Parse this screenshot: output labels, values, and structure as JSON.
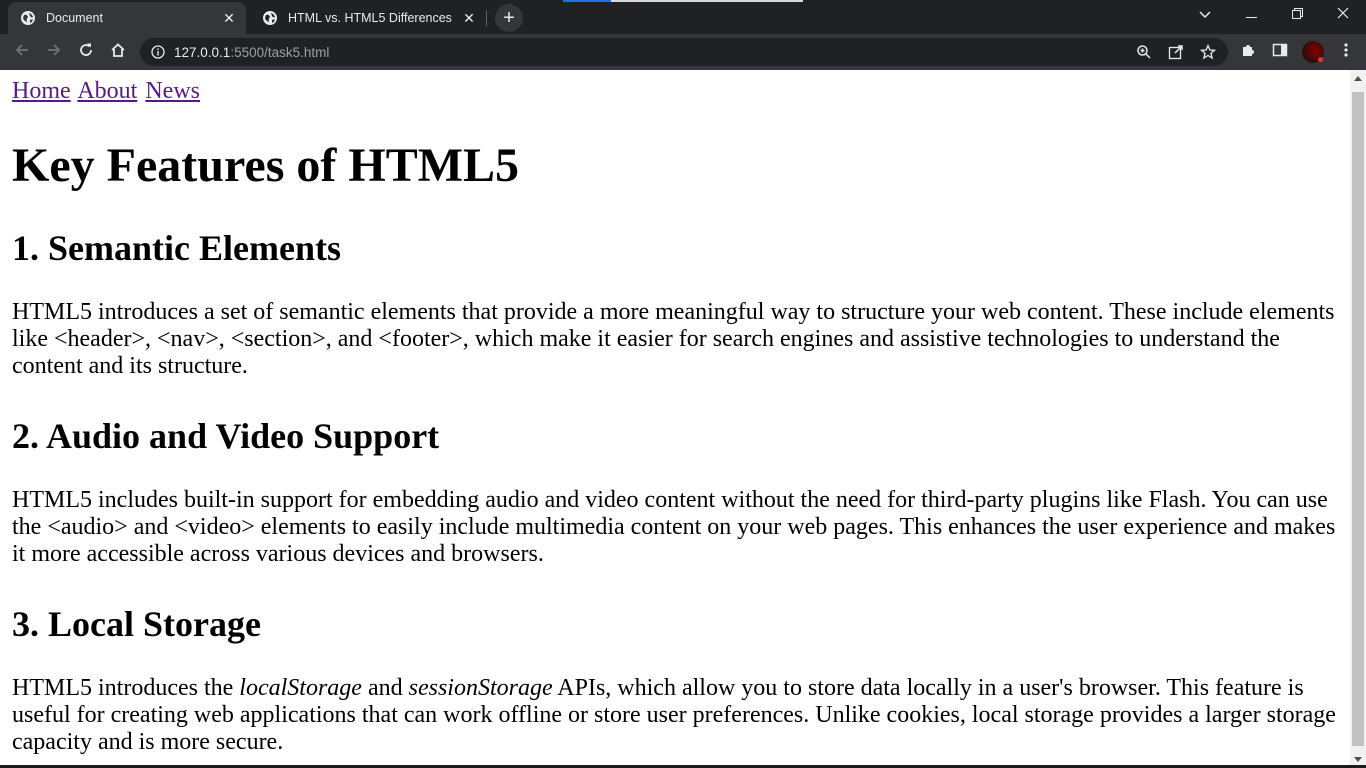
{
  "browser": {
    "tabs": [
      {
        "title": "Document",
        "active": true
      },
      {
        "title": "HTML vs. HTML5 Differences",
        "active": false
      }
    ],
    "new_tab_symbol": "+",
    "close_symbol": "✕",
    "address": {
      "host": "127.0.0.1",
      "rest": ":5500/task5.html"
    },
    "icons": [
      "globe-icon",
      "back-icon",
      "forward-icon",
      "reload-icon",
      "home-icon",
      "info-icon",
      "zoom-icon",
      "share-icon",
      "star-icon",
      "extensions-icon",
      "side-panel-icon",
      "profile-avatar",
      "menu-icon",
      "chevron-down-icon",
      "minimize-icon",
      "restore-icon",
      "close-window-icon"
    ],
    "colors": {
      "frame": "#202124",
      "toolbar": "#35363a",
      "link_visited": "#551a8b"
    }
  },
  "page": {
    "nav": [
      "Home",
      "About",
      "News"
    ],
    "title": "Key Features of HTML5",
    "sections": [
      {
        "heading": "1. Semantic Elements",
        "text": "HTML5 introduces a set of semantic elements that provide a more meaningful way to structure your web content. These include elements like <header>, <nav>, <section>, and <footer>, which make it easier for search engines and assistive technologies to understand the content and its structure."
      },
      {
        "heading": "2. Audio and Video Support",
        "text": "HTML5 includes built-in support for embedding audio and video content without the need for third-party plugins like Flash. You can use the <audio> and <video> elements to easily include multimedia content on your web pages. This enhances the user experience and makes it more accessible across various devices and browsers."
      },
      {
        "heading": "3. Local Storage",
        "text_before": "HTML5 introduces the ",
        "em1": "localStorage",
        "text_mid": " and ",
        "em2": "sessionStorage",
        "text_after": " APIs, which allow you to store data locally in a user's browser. This feature is useful for creating web applications that can work offline or store user preferences. Unlike cookies, local storage provides a larger storage capacity and is more secure."
      }
    ]
  }
}
